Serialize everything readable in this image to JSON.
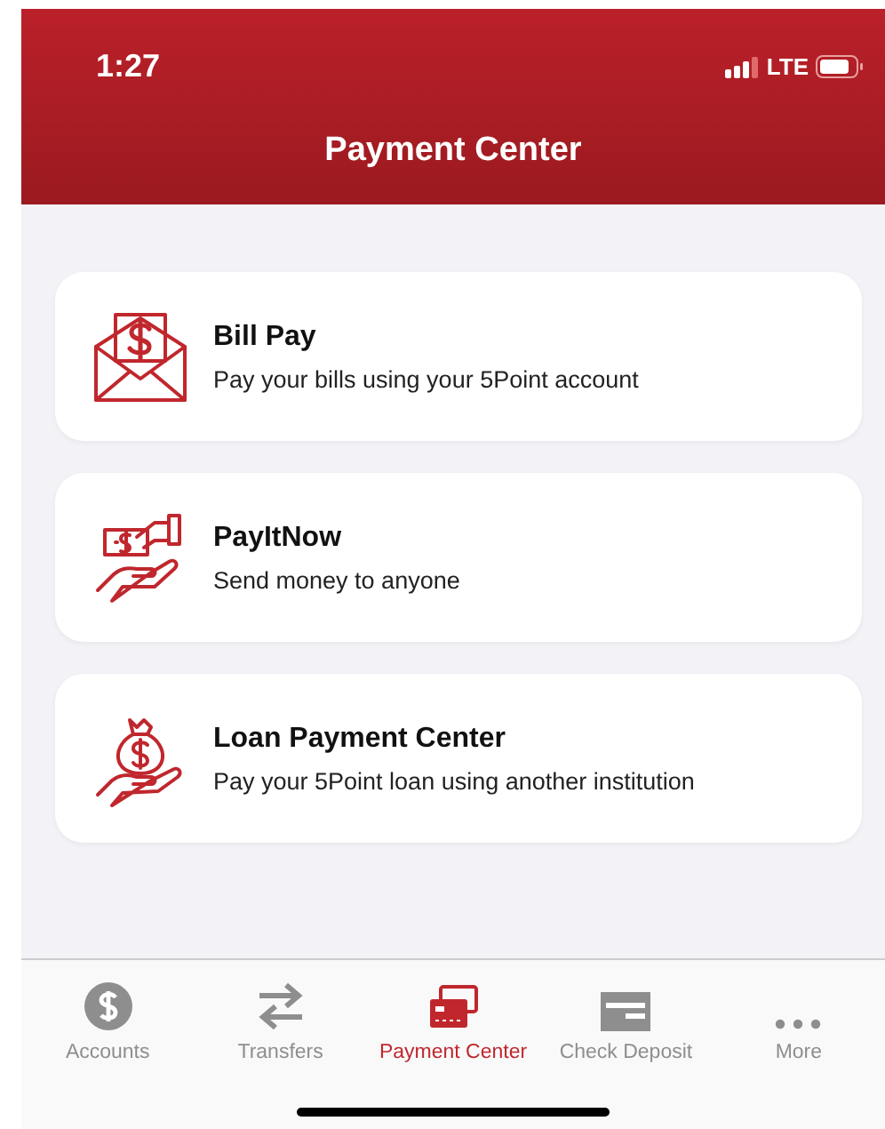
{
  "status_bar": {
    "time": "1:27",
    "network": "LTE"
  },
  "header": {
    "title": "Payment Center"
  },
  "options": [
    {
      "kind": "envelope",
      "title": "Bill Pay",
      "subtitle": "Pay your bills using your 5Point account"
    },
    {
      "kind": "handoff",
      "title": "PayItNow",
      "subtitle": "Send money to anyone"
    },
    {
      "kind": "moneybag",
      "title": "Loan Payment Center",
      "subtitle": "Pay your 5Point loan using another institution"
    }
  ],
  "tabs": [
    {
      "kind": "dollar",
      "label": "Accounts",
      "selected": false
    },
    {
      "kind": "arrows",
      "label": "Transfers",
      "selected": false
    },
    {
      "kind": "cards",
      "label": "Payment Center",
      "selected": true
    },
    {
      "kind": "check",
      "label": "Check Deposit",
      "selected": false
    },
    {
      "kind": "dots",
      "label": "More",
      "selected": false
    }
  ]
}
